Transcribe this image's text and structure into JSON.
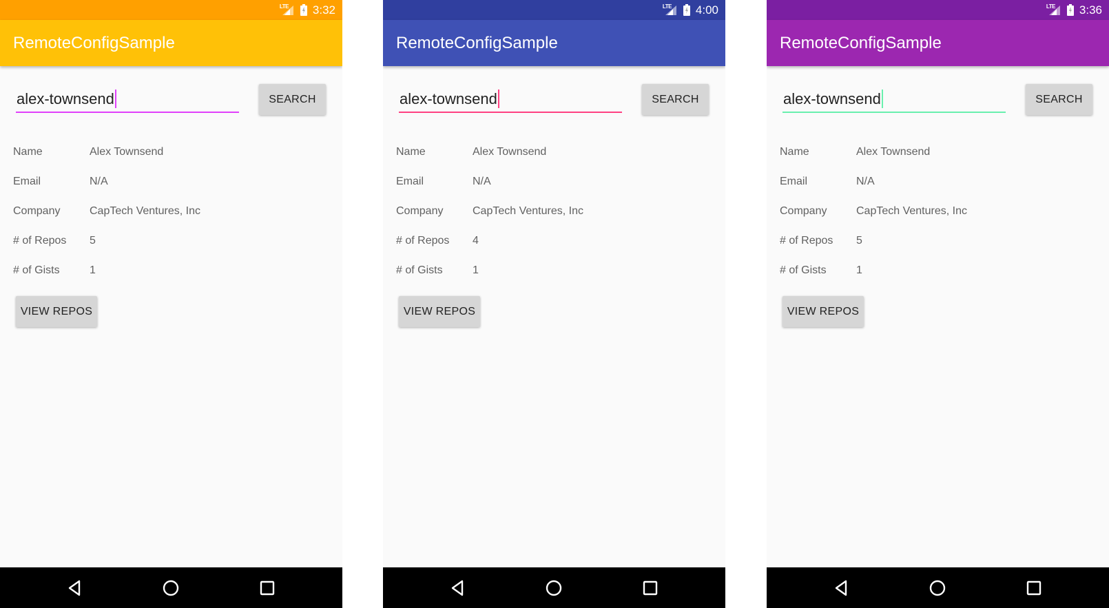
{
  "phones": [
    {
      "status_time": "3:32",
      "network_label": "LTE",
      "app_title": "RemoteConfigSample",
      "search": {
        "value": "alex-townsend",
        "button_label": "SEARCH"
      },
      "fields": [
        {
          "label": "Name",
          "value": "Alex Townsend"
        },
        {
          "label": "Email",
          "value": "N/A"
        },
        {
          "label": "Company",
          "value": "CapTech Ventures, Inc"
        },
        {
          "label": "# of Repos",
          "value": "5"
        },
        {
          "label": "# of Gists",
          "value": "1"
        }
      ],
      "view_repos_label": "VIEW REPOS",
      "colors": {
        "status_bar": "#FFA000",
        "app_bar": "#FFC107",
        "accent": "#E040FB"
      }
    },
    {
      "status_time": "4:00",
      "network_label": "LTE",
      "app_title": "RemoteConfigSample",
      "search": {
        "value": "alex-townsend",
        "button_label": "SEARCH"
      },
      "fields": [
        {
          "label": "Name",
          "value": "Alex Townsend"
        },
        {
          "label": "Email",
          "value": "N/A"
        },
        {
          "label": "Company",
          "value": "CapTech Ventures, Inc"
        },
        {
          "label": "# of Repos",
          "value": "4"
        },
        {
          "label": "# of Gists",
          "value": "1"
        }
      ],
      "view_repos_label": "VIEW REPOS",
      "colors": {
        "status_bar": "#303F9F",
        "app_bar": "#3F51B5",
        "accent": "#FF4081"
      }
    },
    {
      "status_time": "3:36",
      "network_label": "LTE",
      "app_title": "RemoteConfigSample",
      "search": {
        "value": "alex-townsend",
        "button_label": "SEARCH"
      },
      "fields": [
        {
          "label": "Name",
          "value": "Alex Townsend"
        },
        {
          "label": "Email",
          "value": "N/A"
        },
        {
          "label": "Company",
          "value": "CapTech Ventures, Inc"
        },
        {
          "label": "# of Repos",
          "value": "5"
        },
        {
          "label": "# of Gists",
          "value": "1"
        }
      ],
      "view_repos_label": "VIEW REPOS",
      "colors": {
        "status_bar": "#7B1FA2",
        "app_bar": "#9C27B0",
        "accent": "#69F0AE"
      }
    }
  ],
  "nav_icons": [
    "back-icon",
    "home-icon",
    "recent-apps-icon"
  ]
}
